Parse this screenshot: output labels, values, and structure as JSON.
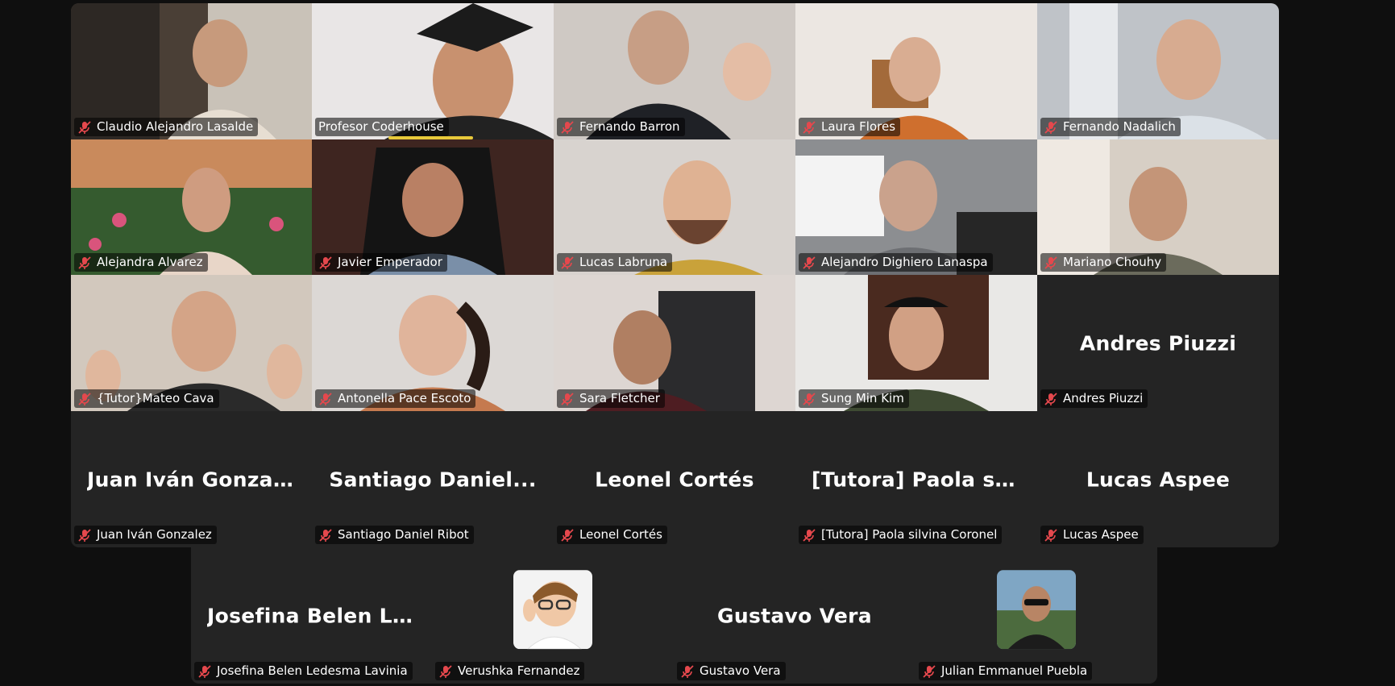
{
  "colors": {
    "background": "#0f0f0f",
    "tile": "#242424",
    "active_border": "#23d96b",
    "muted_icon": "#e5484d",
    "speaking_bar": "#e8c93a"
  },
  "tiles": [
    {
      "name": "Claudio Alejandro Lasalde",
      "video": true,
      "muted": true
    },
    {
      "name": "Profesor Coderhouse",
      "video": true,
      "muted": false,
      "speaking": true
    },
    {
      "name": "Fernando Barron",
      "video": true,
      "muted": true
    },
    {
      "name": "Laura Flores",
      "video": true,
      "muted": true
    },
    {
      "name": "Fernando Nadalich",
      "video": true,
      "muted": true
    },
    {
      "name": "Alejandra Alvarez",
      "video": true,
      "muted": true,
      "active": true
    },
    {
      "name": "Javier Emperador",
      "video": true,
      "muted": true
    },
    {
      "name": "Lucas Labruna",
      "video": true,
      "muted": true
    },
    {
      "name": "Alejandro Dighiero Lanaspa",
      "video": true,
      "muted": true
    },
    {
      "name": "Mariano Chouhy",
      "video": true,
      "muted": true
    },
    {
      "name": "{Tutor}Mateo Cava",
      "video": true,
      "muted": true
    },
    {
      "name": "Antonella Pace Escoto",
      "video": true,
      "muted": true
    },
    {
      "name": "Sara Fletcher",
      "video": true,
      "muted": true
    },
    {
      "name": "Sung Min Kim",
      "video": true,
      "muted": true
    },
    {
      "name": "Andres Piuzzi",
      "display": "Andres Piuzzi",
      "video": false,
      "muted": true
    },
    {
      "name": "Juan Iván Gonzalez",
      "display": "Juan Iván Gonza...",
      "video": false,
      "muted": true
    },
    {
      "name": "Santiago Daniel Ribot",
      "display": "Santiago Daniel...",
      "video": false,
      "muted": true
    },
    {
      "name": "Leonel Cortés",
      "display": "Leonel Cortés",
      "video": false,
      "muted": true
    },
    {
      "name": "[Tutora] Paola silvina Coronel",
      "display": "[Tutora] Paola si...",
      "video": false,
      "muted": true
    },
    {
      "name": "Lucas Aspee",
      "display": "Lucas Aspee",
      "video": false,
      "muted": true
    },
    {
      "name": "Josefina Belen Ledesma Lavinia",
      "display": "Josefina Belen L...",
      "video": false,
      "muted": true
    },
    {
      "name": "Verushka Fernandez",
      "video": false,
      "avatar": "memoji-avatar",
      "muted": true
    },
    {
      "name": "Gustavo Vera",
      "display": "Gustavo Vera",
      "video": false,
      "muted": true
    },
    {
      "name": "Julian Emmanuel Puebla",
      "video": false,
      "avatar": "photo-avatar",
      "muted": true
    }
  ]
}
